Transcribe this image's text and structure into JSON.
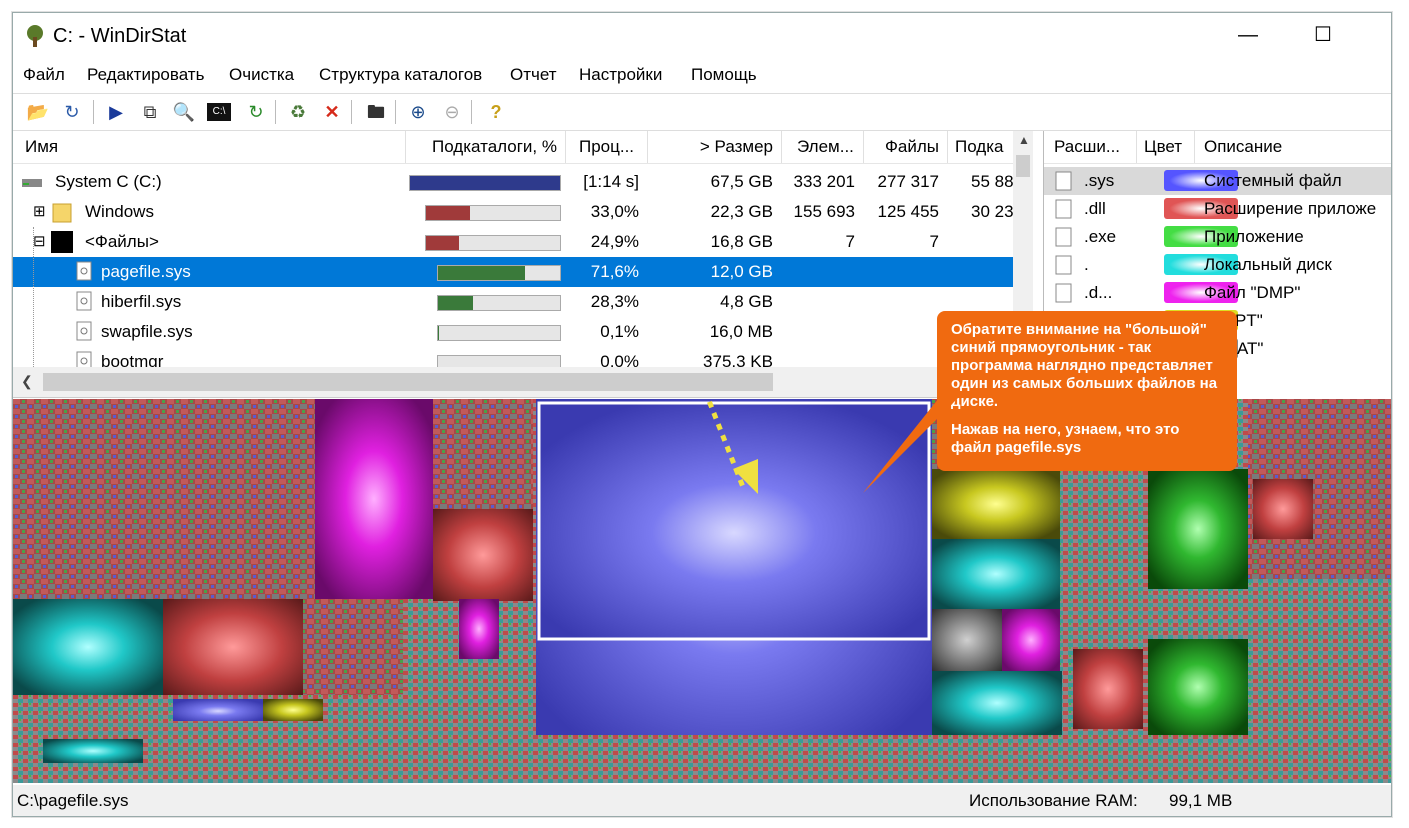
{
  "window": {
    "title": "C: - WinDirStat",
    "minimize": "—",
    "maximize": "☐"
  },
  "menu": [
    "Файл",
    "Редактировать",
    "Очистка",
    "Структура каталогов",
    "Отчет",
    "Настройки",
    "Помощь"
  ],
  "toolbar_icons": [
    "open-folder-icon",
    "refresh-icon",
    "play-icon",
    "copy-icon",
    "explore-icon",
    "command-prompt-icon",
    "refresh-selected-icon",
    "recycle-icon",
    "delete-icon",
    "new-folder-icon",
    "zoom-in-icon",
    "zoom-out-icon",
    "help-icon"
  ],
  "tree": {
    "headers": [
      "Имя",
      "Подкаталоги, %",
      "Проц...",
      "> Размер",
      "Элем...",
      "Файлы",
      "Подка"
    ],
    "rows": [
      {
        "name": "System C (C:)",
        "percent": "[1:14 s]",
        "size": "67,5 GB",
        "items": "333 201",
        "files": "277 317",
        "subdirs": "55 88",
        "bar_fraction": 1.0,
        "bar_color": "#2e3a8c",
        "expander": "",
        "icon": "drive-icon"
      },
      {
        "name": "Windows",
        "percent": "33,0%",
        "size": "22,3 GB",
        "items": "155 693",
        "files": "125 455",
        "subdirs": "30 23",
        "bar_fraction": 0.33,
        "bar_color": "#a03a3a",
        "expander": "⊞",
        "icon": "folder-icon"
      },
      {
        "name": "<Файлы>",
        "percent": "24,9%",
        "size": "16,8 GB",
        "items": "7",
        "files": "7",
        "subdirs": "",
        "bar_fraction": 0.249,
        "bar_color": "#a03a3a",
        "expander": "⊟",
        "icon": "files-icon"
      },
      {
        "name": "pagefile.sys",
        "percent": "71,6%",
        "size": "12,0 GB",
        "items": "",
        "files": "",
        "subdirs": "",
        "bar_fraction": 0.716,
        "bar_color": "#3a7a3a",
        "expander": "",
        "icon": "file-icon"
      },
      {
        "name": "hiberfil.sys",
        "percent": "28,3%",
        "size": "4,8 GB",
        "items": "",
        "files": "",
        "subdirs": "",
        "bar_fraction": 0.283,
        "bar_color": "#3a7a3a",
        "expander": "",
        "icon": "file-icon"
      },
      {
        "name": "swapfile.sys",
        "percent": "0,1%",
        "size": "16,0 MB",
        "items": "",
        "files": "",
        "subdirs": "",
        "bar_fraction": 0.001,
        "bar_color": "#3a7a3a",
        "expander": "",
        "icon": "file-icon"
      },
      {
        "name": "bootmgr",
        "percent": "0,0%",
        "size": "375,3 KB",
        "items": "",
        "files": "",
        "subdirs": "",
        "bar_fraction": 0.0,
        "bar_color": "#3a7a3a",
        "expander": "",
        "icon": "file-icon"
      }
    ]
  },
  "extensions": {
    "headers": [
      "Расши...",
      "Цвет",
      "Описание"
    ],
    "rows": [
      {
        "ext": ".sys",
        "color": "#5555ff",
        "desc": "Системный файл",
        "icon": "sys-file-icon"
      },
      {
        "ext": ".dll",
        "color": "#e05555",
        "desc": "Расширение приложе",
        "icon": "dll-file-icon"
      },
      {
        "ext": ".exe",
        "color": "#44dd44",
        "desc": "Приложение",
        "icon": "exe-file-icon"
      },
      {
        "ext": ".",
        "color": "#22dddd",
        "desc": "Локальный диск",
        "icon": "drive-small-icon"
      },
      {
        "ext": ".d...",
        "color": "#ee22ee",
        "desc": "Файл \"DMP\"",
        "icon": "blank-file-icon"
      },
      {
        "ext": "",
        "color": "#dddd22",
        "desc": "л \"FPT\"",
        "icon": ""
      },
      {
        "ext": "",
        "color": "#888888",
        "desc": "л \"DAT\"",
        "icon": ""
      }
    ]
  },
  "callout": {
    "paragraph1": "Обратите внимание на \"большой\" синий прямоугольник - так программа наглядно представляет один из самых больших файлов на диске.",
    "paragraph2": "Нажав на него, узнаем, что это файл pagefile.sys"
  },
  "status": {
    "path": "C:\\pagefile.sys",
    "ram_label": "Использование RAM:",
    "ram_value": "99,1 MB"
  },
  "colors": {
    "selection": "#0078d7",
    "callout": "#f06a10",
    "highlight_block": "#5a5ae6"
  }
}
